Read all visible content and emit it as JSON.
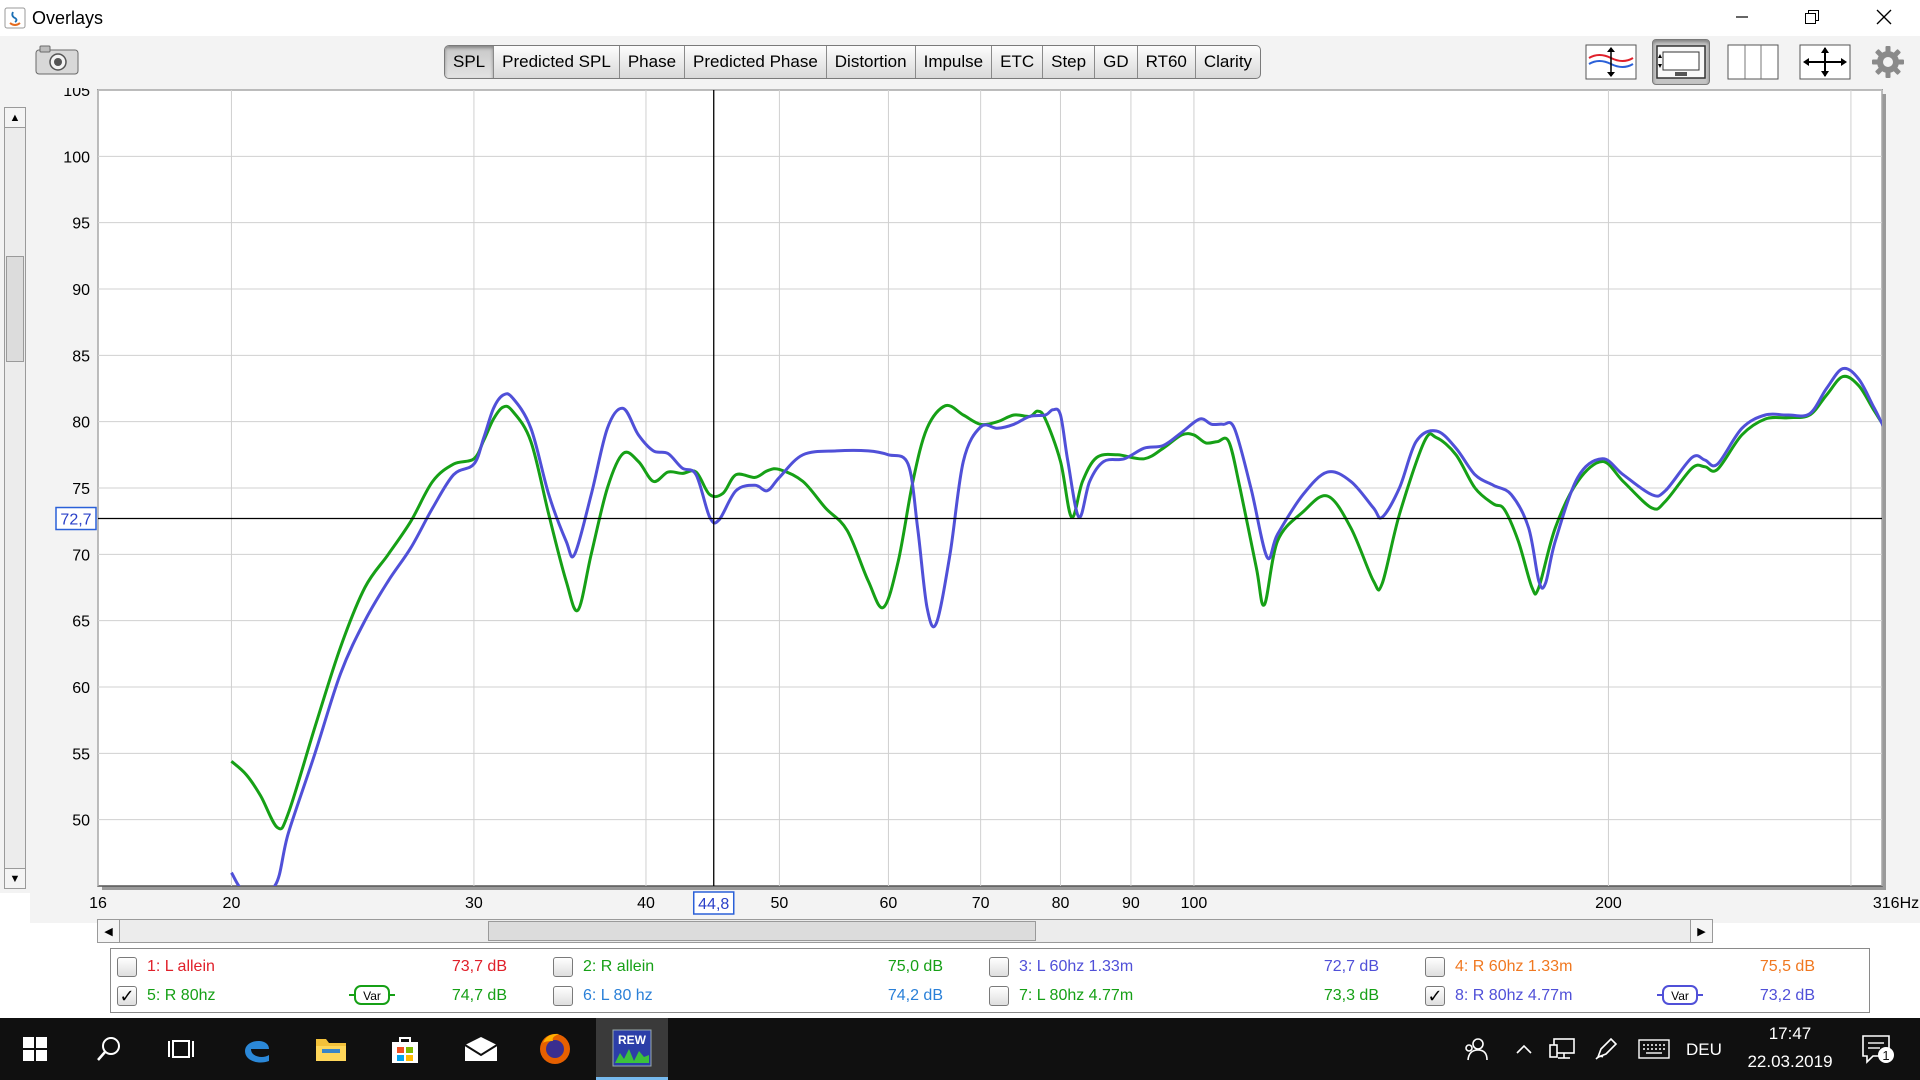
{
  "window": {
    "title": "Overlays",
    "controls": [
      "minimize-icon",
      "restore-icon",
      "close-icon"
    ]
  },
  "toolbar": {
    "tabs": [
      {
        "label": "SPL",
        "active": true
      },
      {
        "label": "Predicted SPL",
        "active": false
      },
      {
        "label": "Phase",
        "active": false
      },
      {
        "label": "Predicted Phase",
        "active": false
      },
      {
        "label": "Distortion",
        "active": false
      },
      {
        "label": "Impulse",
        "active": false
      },
      {
        "label": "ETC",
        "active": false
      },
      {
        "label": "Step",
        "active": false
      },
      {
        "label": "GD",
        "active": false
      },
      {
        "label": "RT60",
        "active": false
      },
      {
        "label": "Clarity",
        "active": false
      }
    ],
    "right_icons": [
      "overlay-traces-icon",
      "graph-limits-icon",
      "split-view-icon",
      "move-arrows-icon",
      "settings-gear-icon"
    ]
  },
  "chart_data": {
    "type": "line",
    "ylabel": "dB",
    "xunit": "Hz",
    "xscale": "log",
    "xlim": [
      16,
      316
    ],
    "ylim": [
      45,
      105
    ],
    "x_ticks": [
      "16",
      "20",
      "30",
      "40",
      "50",
      "60",
      "70",
      "80",
      "90",
      "100",
      "200",
      "316Hz"
    ],
    "x_tick_values": [
      16,
      20,
      30,
      40,
      50,
      60,
      70,
      80,
      90,
      100,
      200,
      316
    ],
    "y_ticks": [
      50,
      55,
      60,
      65,
      70,
      75,
      80,
      85,
      90,
      95,
      100,
      105
    ],
    "x_minor_ticks": [
      300
    ],
    "grid": true,
    "cursor": {
      "x_label": "44,8",
      "x": 44.8,
      "y_label": "72,7",
      "y": 72.7
    },
    "series": [
      {
        "name": "5: R 80hz",
        "color": "#16a016",
        "points": [
          [
            20,
            54.4
          ],
          [
            20.5,
            53.4
          ],
          [
            21,
            51.8
          ],
          [
            21.6,
            49.4
          ],
          [
            22,
            50.5
          ],
          [
            23,
            57
          ],
          [
            24,
            63
          ],
          [
            25,
            67.5
          ],
          [
            26,
            70
          ],
          [
            27,
            72.5
          ],
          [
            28,
            75.5
          ],
          [
            29,
            76.8
          ],
          [
            30,
            77.2
          ],
          [
            30.5,
            78.6
          ],
          [
            31,
            80.2
          ],
          [
            31.5,
            81.1
          ],
          [
            32,
            80.8
          ],
          [
            33,
            78.5
          ],
          [
            34,
            73
          ],
          [
            35,
            68
          ],
          [
            35.7,
            65.8
          ],
          [
            36.5,
            70
          ],
          [
            37.5,
            75
          ],
          [
            38.5,
            77.6
          ],
          [
            39.5,
            77
          ],
          [
            40.5,
            75.5
          ],
          [
            41.5,
            76.2
          ],
          [
            42.5,
            76.1
          ],
          [
            43.5,
            76.2
          ],
          [
            44.5,
            74.5
          ],
          [
            45.5,
            74.6
          ],
          [
            46.5,
            76
          ],
          [
            48,
            75.8
          ],
          [
            49,
            76.3
          ],
          [
            50,
            76.4
          ],
          [
            52,
            75.5
          ],
          [
            54,
            73.5
          ],
          [
            56,
            71.8
          ],
          [
            58,
            68
          ],
          [
            59.5,
            66
          ],
          [
            61,
            69.5
          ],
          [
            62.5,
            75.5
          ],
          [
            64,
            79.5
          ],
          [
            66,
            81.2
          ],
          [
            68,
            80.5
          ],
          [
            70,
            79.8
          ],
          [
            72,
            80
          ],
          [
            74,
            80.5
          ],
          [
            76,
            80.4
          ],
          [
            77,
            80.8
          ],
          [
            78,
            80.2
          ],
          [
            80,
            77
          ],
          [
            81.5,
            72.8
          ],
          [
            83,
            75.5
          ],
          [
            85,
            77.3
          ],
          [
            88,
            77.5
          ],
          [
            92,
            77.2
          ],
          [
            95,
            78
          ],
          [
            98,
            79
          ],
          [
            100,
            79
          ],
          [
            102,
            78.4
          ],
          [
            104,
            78.5
          ],
          [
            106,
            78.5
          ],
          [
            108,
            75
          ],
          [
            111,
            69
          ],
          [
            112.5,
            66.2
          ],
          [
            115,
            71
          ],
          [
            120,
            73.2
          ],
          [
            125,
            74.4
          ],
          [
            130,
            72
          ],
          [
            135,
            68
          ],
          [
            137,
            67.8
          ],
          [
            141,
            73
          ],
          [
            147,
            78.5
          ],
          [
            150,
            78.8
          ],
          [
            155,
            77.5
          ],
          [
            160,
            75
          ],
          [
            165,
            73.8
          ],
          [
            168,
            73.4
          ],
          [
            172,
            71
          ],
          [
            176,
            67.5
          ],
          [
            178,
            67.5
          ],
          [
            183,
            72
          ],
          [
            190,
            75.5
          ],
          [
            198,
            77
          ],
          [
            205,
            75.5
          ],
          [
            215,
            73.5
          ],
          [
            220,
            74
          ],
          [
            230,
            76.5
          ],
          [
            235,
            76.6
          ],
          [
            240,
            76.4
          ],
          [
            250,
            79
          ],
          [
            260,
            80.2
          ],
          [
            270,
            80.3
          ],
          [
            280,
            80.5
          ],
          [
            288,
            82
          ],
          [
            296,
            83.4
          ],
          [
            304,
            82.7
          ],
          [
            312,
            80.8
          ],
          [
            320,
            79.2
          ],
          [
            330,
            78.7
          ],
          [
            340,
            79.2
          ],
          [
            350,
            79.8
          ],
          [
            360,
            79.8
          ]
        ]
      },
      {
        "name": "8: R 80hz 4.77m",
        "color": "#5050d8",
        "points": [
          [
            20,
            46
          ],
          [
            20.5,
            44.5
          ],
          [
            21.5,
            45
          ],
          [
            22,
            49
          ],
          [
            23,
            55
          ],
          [
            24,
            61
          ],
          [
            25,
            65
          ],
          [
            26,
            68
          ],
          [
            27,
            70.5
          ],
          [
            28,
            73.5
          ],
          [
            29,
            76
          ],
          [
            30,
            76.8
          ],
          [
            30.5,
            78.8
          ],
          [
            31,
            81
          ],
          [
            31.5,
            82
          ],
          [
            32,
            81.8
          ],
          [
            33,
            79.5
          ],
          [
            34,
            74.5
          ],
          [
            35,
            71
          ],
          [
            35.5,
            70
          ],
          [
            36.5,
            74.5
          ],
          [
            37.5,
            79.5
          ],
          [
            38.5,
            81
          ],
          [
            39.5,
            79
          ],
          [
            40.5,
            77.8
          ],
          [
            41.5,
            77.6
          ],
          [
            42.5,
            76.5
          ],
          [
            43.5,
            76
          ],
          [
            44.5,
            72.8
          ],
          [
            45.2,
            72.6
          ],
          [
            46.5,
            74.8
          ],
          [
            48,
            75.2
          ],
          [
            49,
            74.8
          ],
          [
            50,
            75.8
          ],
          [
            52,
            77.5
          ],
          [
            55,
            77.8
          ],
          [
            58,
            77.8
          ],
          [
            60,
            77.5
          ],
          [
            62,
            76.8
          ],
          [
            63,
            72
          ],
          [
            64,
            66
          ],
          [
            65,
            64.8
          ],
          [
            66.5,
            70
          ],
          [
            68,
            77
          ],
          [
            70,
            79.6
          ],
          [
            72,
            79.5
          ],
          [
            74,
            79.8
          ],
          [
            76,
            80.4
          ],
          [
            78,
            80.5
          ],
          [
            79,
            80.9
          ],
          [
            80,
            80.5
          ],
          [
            81,
            77
          ],
          [
            82.5,
            72.8
          ],
          [
            84,
            75.5
          ],
          [
            86,
            77
          ],
          [
            89,
            77.2
          ],
          [
            92,
            78
          ],
          [
            95,
            78.2
          ],
          [
            98,
            79.2
          ],
          [
            101,
            80.2
          ],
          [
            103,
            79.8
          ],
          [
            105,
            79.8
          ],
          [
            107,
            79.5
          ],
          [
            110,
            75
          ],
          [
            113,
            69.8
          ],
          [
            115,
            71.5
          ],
          [
            120,
            74.5
          ],
          [
            125,
            76.2
          ],
          [
            130,
            75.5
          ],
          [
            135,
            73.5
          ],
          [
            137,
            72.8
          ],
          [
            141,
            75
          ],
          [
            145,
            78.5
          ],
          [
            150,
            79.3
          ],
          [
            155,
            78
          ],
          [
            160,
            76
          ],
          [
            165,
            75.2
          ],
          [
            170,
            74.5
          ],
          [
            175,
            72
          ],
          [
            178,
            68
          ],
          [
            180,
            67.8
          ],
          [
            183,
            71
          ],
          [
            190,
            75.8
          ],
          [
            198,
            77.2
          ],
          [
            205,
            76
          ],
          [
            215,
            74.5
          ],
          [
            220,
            74.8
          ],
          [
            230,
            77.3
          ],
          [
            235,
            77.1
          ],
          [
            240,
            76.8
          ],
          [
            250,
            79.5
          ],
          [
            260,
            80.5
          ],
          [
            270,
            80.5
          ],
          [
            280,
            80.6
          ],
          [
            288,
            82.5
          ],
          [
            296,
            84
          ],
          [
            304,
            83.2
          ],
          [
            312,
            81
          ],
          [
            320,
            79
          ],
          [
            330,
            78.5
          ],
          [
            340,
            78.8
          ],
          [
            350,
            79
          ],
          [
            360,
            79
          ]
        ]
      }
    ]
  },
  "legend": {
    "items": [
      {
        "index": "1",
        "label": "1: L allein",
        "value": "73,7 dB",
        "checked": false,
        "var": false,
        "color": "#e0202a"
      },
      {
        "index": "2",
        "label": "2: R allein",
        "value": "75,0 dB",
        "checked": false,
        "var": false,
        "color": "#16a016"
      },
      {
        "index": "3",
        "label": "3: L 60hz 1.33m",
        "value": "72,7 dB",
        "checked": false,
        "var": false,
        "color": "#5050d8"
      },
      {
        "index": "4",
        "label": "4: R 60hz 1.33m",
        "value": "75,5 dB",
        "checked": false,
        "var": false,
        "color": "#f07820"
      },
      {
        "index": "5",
        "label": "5: R 80hz",
        "value": "74,7 dB",
        "checked": true,
        "var": true,
        "var_label": "Var",
        "color": "#16a016"
      },
      {
        "index": "6",
        "label": "6: L 80 hz",
        "value": "74,2 dB",
        "checked": false,
        "var": false,
        "color": "#2a80d8"
      },
      {
        "index": "7",
        "label": "7: L 80hz 4.77m",
        "value": "73,3 dB",
        "checked": false,
        "var": false,
        "color": "#16a016"
      },
      {
        "index": "8",
        "label": "8: R 80hz 4.77m",
        "value": "73,2 dB",
        "checked": true,
        "var": true,
        "var_label": "Var",
        "color": "#5050d8"
      }
    ]
  },
  "taskbar": {
    "icons": [
      "windows-start-icon",
      "search-icon",
      "task-view-icon",
      "edge-browser-icon",
      "file-explorer-icon",
      "store-icon",
      "mail-icon",
      "firefox-icon",
      "rew-app-icon"
    ],
    "tray_icons": [
      "people-icon",
      "tray-chevron-up-icon",
      "network-icon",
      "pen-icon",
      "keyboard-icon",
      "notification-icon"
    ],
    "language": "DEU",
    "time": "17:47",
    "date": "22.03.2019",
    "notification_count": "1",
    "rew_label": "REW"
  }
}
